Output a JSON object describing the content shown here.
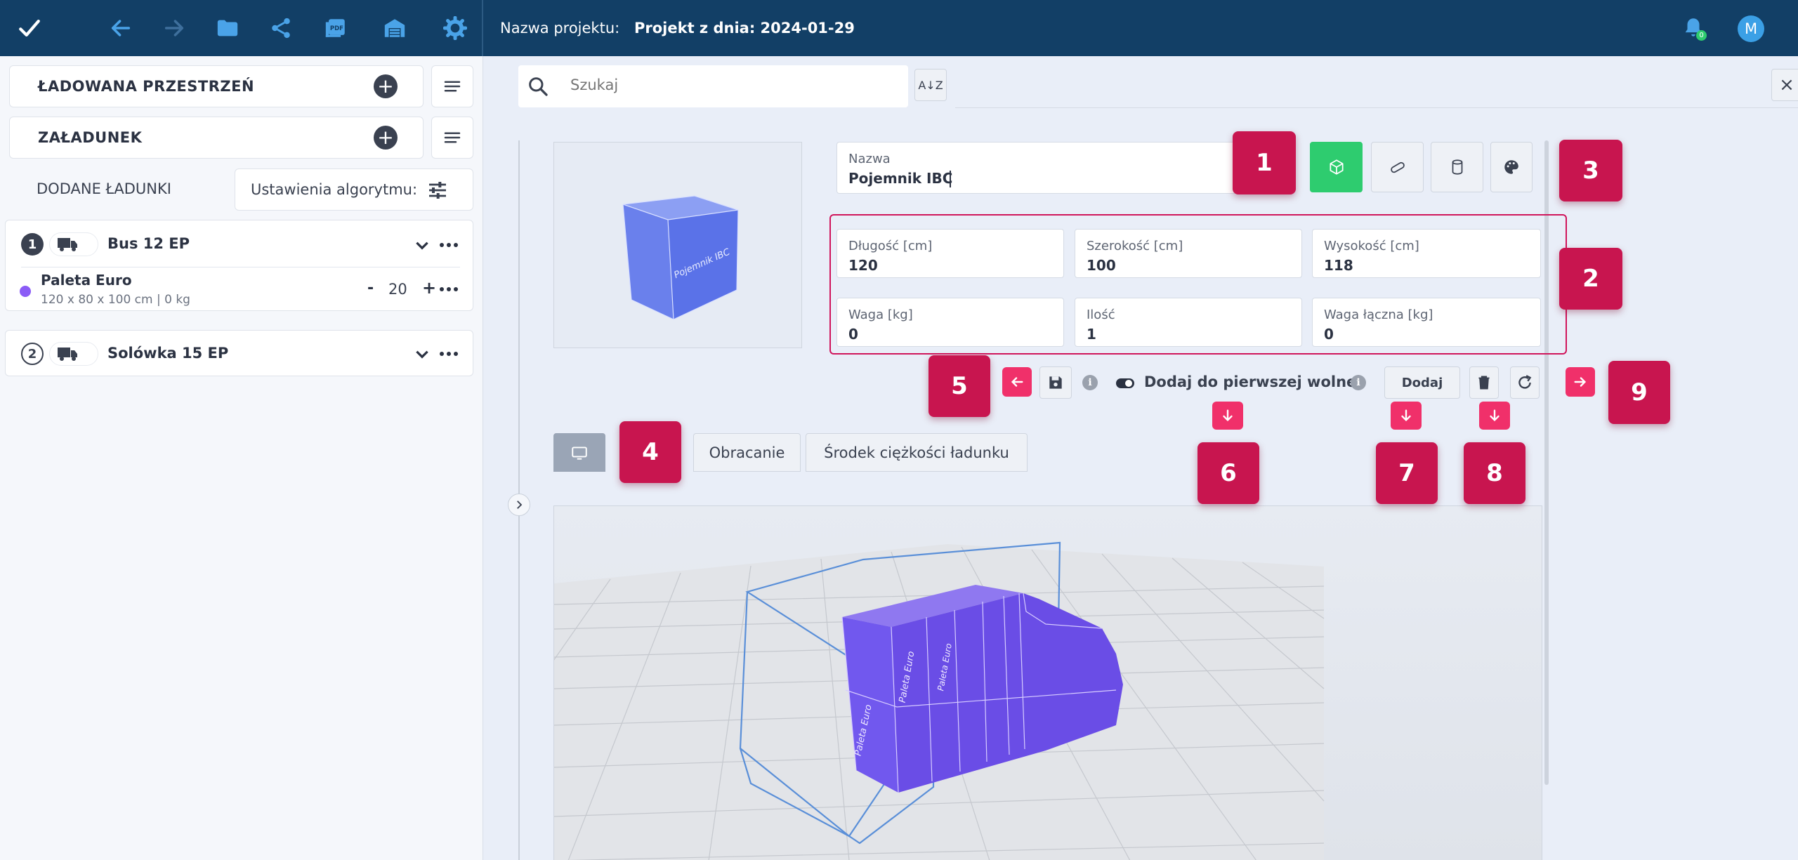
{
  "topbar": {
    "project_label": "Nazwa projektu:",
    "project_name": "Projekt z dnia: 2024-01-29",
    "avatar_letter": "M",
    "notification_count": "0"
  },
  "sidebar": {
    "loading_space": "ŁADOWANA PRZESTRZEŃ",
    "loading": "ZAŁADUNEK",
    "added_loads": "DODANE ŁADUNKI",
    "algo_settings": "Ustawienia algorytmu:",
    "vehicles": [
      {
        "number": "1",
        "name": "Bus 12 EP"
      },
      {
        "number": "2",
        "name": "Solówka 15 EP"
      }
    ],
    "load_item": {
      "name": "Paleta Euro",
      "details": "120 x 80 x 100 cm | 0 kg",
      "minus": "-",
      "quantity": "20",
      "plus": "+",
      "color": "#8b5cf6"
    }
  },
  "search": {
    "placeholder": "Szukaj",
    "sort_label": "A↓Z",
    "close": "×"
  },
  "form": {
    "name_label": "Nazwa",
    "name_value": "Pojemnik IBC",
    "preview_text": "Pojemnik IBC",
    "length_label": "Długość [cm]",
    "length_value": "120",
    "width_label": "Szerokość [cm]",
    "width_value": "100",
    "height_label": "Wysokość [cm]",
    "height_value": "118",
    "weight_label": "Waga [kg]",
    "weight_value": "0",
    "qty_label": "Ilość",
    "qty_value": "1",
    "total_weight_label": "Waga łączna [kg]",
    "total_weight_value": "0"
  },
  "actions": {
    "add_first_free": "Dodaj do pierwszej wolnej",
    "add": "Dodaj"
  },
  "tabs": [
    "Obracanie",
    "Środek ciężkości ładunku"
  ],
  "badges": [
    "1",
    "2",
    "3",
    "4",
    "5",
    "6",
    "7",
    "8",
    "9"
  ],
  "view3d": {
    "pallet_label": "Paleta Euro"
  },
  "colors": {
    "accent": "#c8154f",
    "topbar": "#123f66",
    "cube": "#6f86ef",
    "pallet": "#7c5cf0",
    "active_shape": "#2ecc6f"
  }
}
